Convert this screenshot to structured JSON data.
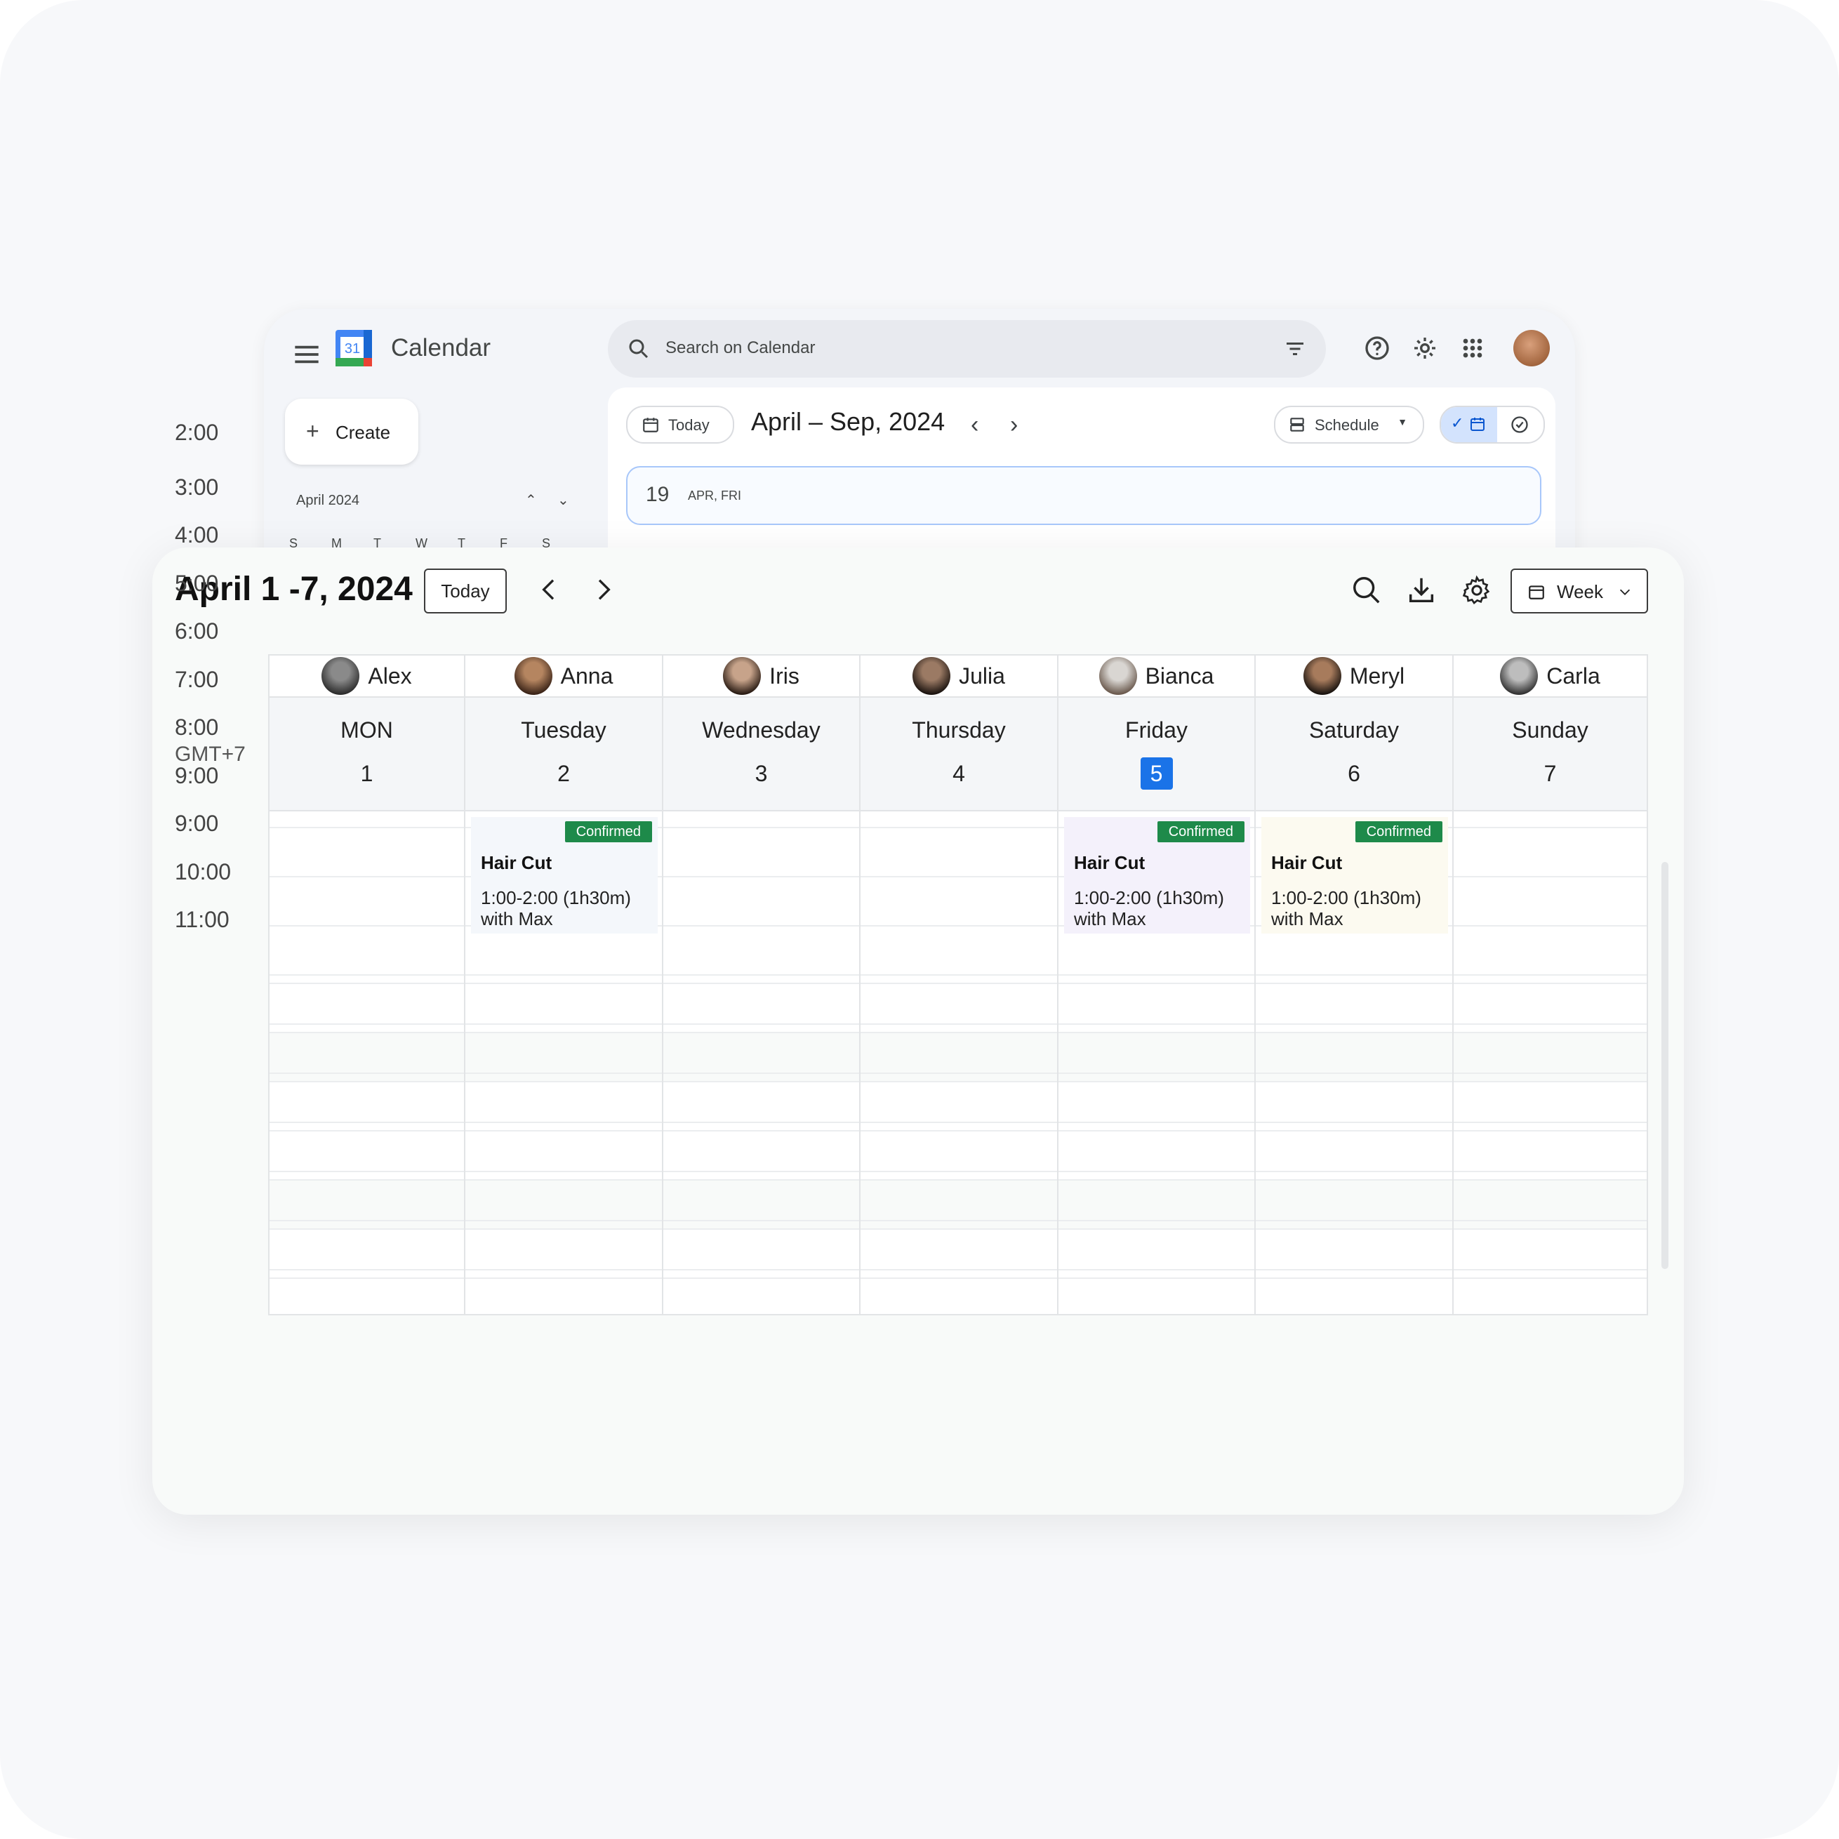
{
  "back_window": {
    "app_title": "Calendar",
    "logo_number": "31",
    "search_placeholder": "Search on Calendar",
    "create_label": "Create",
    "mini_month": "April 2024",
    "mini_weekdays": [
      "S",
      "M",
      "T",
      "W",
      "T",
      "F",
      "S"
    ],
    "today_label": "Today",
    "range_label": "April – Sep, 2024",
    "view_label": "Schedule",
    "date_row": {
      "day_number": "19",
      "weekday": "APR, FRI"
    }
  },
  "toolbar": {
    "title": "April 1 -7, 2024",
    "today_label": "Today",
    "view_label": "Week"
  },
  "timezone": "GMT+7",
  "time_labels": [
    "2:00",
    "3:00",
    "4:00",
    "5:00",
    "6:00",
    "7:00",
    "8:00",
    "9:00",
    "9:00",
    "10:00",
    "11:00"
  ],
  "columns": [
    {
      "staff": "Alex",
      "day_name": "MON",
      "day_num": "1",
      "avatar_colors": [
        "#8a8a8a",
        "#2d2d2d"
      ]
    },
    {
      "staff": "Anna",
      "day_name": "Tuesday",
      "day_num": "2",
      "avatar_colors": [
        "#b58560",
        "#3b2418"
      ]
    },
    {
      "staff": "Iris",
      "day_name": "Wednesday",
      "day_num": "3",
      "avatar_colors": [
        "#c7a38a",
        "#2a1c14"
      ]
    },
    {
      "staff": "Julia",
      "day_name": "Thursday",
      "day_num": "4",
      "avatar_colors": [
        "#9b7a64",
        "#1c1410"
      ]
    },
    {
      "staff": "Bianca",
      "day_name": "Friday",
      "day_num": "5",
      "avatar_colors": [
        "#d9d6d2",
        "#6b5a4e"
      ],
      "today": true
    },
    {
      "staff": "Meryl",
      "day_name": "Saturday",
      "day_num": "6",
      "avatar_colors": [
        "#a77b5c",
        "#1a1410"
      ]
    },
    {
      "staff": "Carla",
      "day_name": "Sunday",
      "day_num": "7",
      "avatar_colors": [
        "#bdbdbd",
        "#333333"
      ]
    }
  ],
  "events": [
    {
      "column": 1,
      "status": "Confirmed",
      "title": "Hair Cut",
      "time": "1:00-2:00 (1h30m)",
      "with": "with Max",
      "bg": "#f4f7fb"
    },
    {
      "column": 4,
      "status": "Confirmed",
      "title": "Hair Cut",
      "time": "1:00-2:00 (1h30m)",
      "with": "with Max",
      "bg": "#f4f1fb"
    },
    {
      "column": 5,
      "status": "Confirmed",
      "title": "Hair Cut",
      "time": "1:00-2:00 (1h30m)",
      "with": "with Max",
      "bg": "#fcfaf0"
    }
  ],
  "colors": {
    "accent": "#1a73e8",
    "confirmed_badge": "#1e8a4a",
    "grid_line": "#e2e4e6"
  }
}
